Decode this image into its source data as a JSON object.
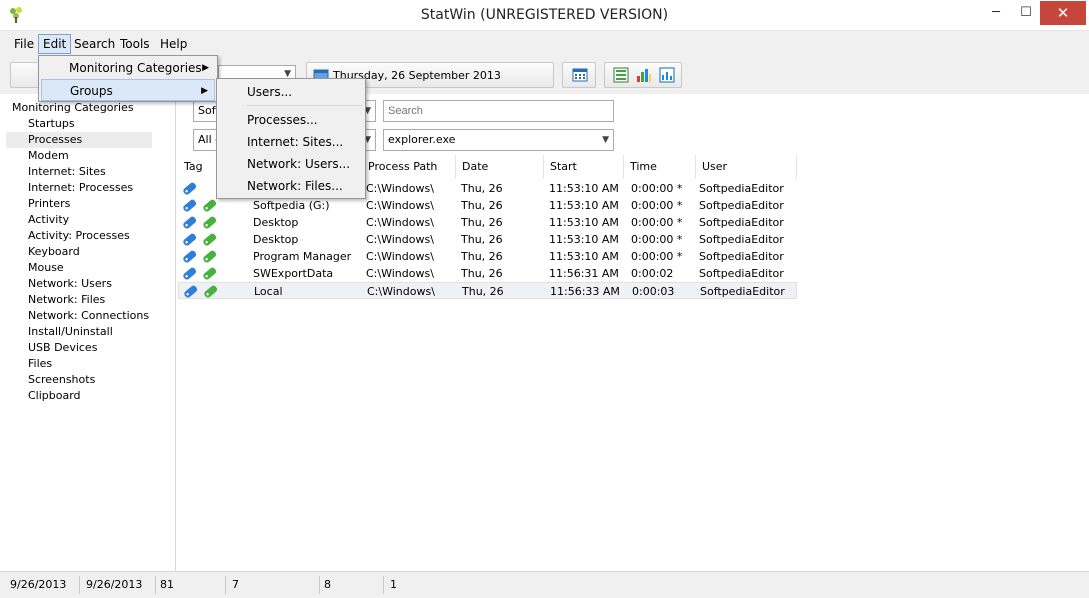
{
  "window": {
    "title": "StatWin (UNREGISTERED VERSION)",
    "min_glyph": "─",
    "max_glyph": "☐",
    "close_glyph": "✕"
  },
  "menu": {
    "file": "File",
    "edit": "Edit",
    "search": "Search",
    "tools": "Tools",
    "help": "Help"
  },
  "edit_menu": {
    "items": [
      "Monitoring Categories",
      "Groups"
    ]
  },
  "groups_submenu": {
    "items": [
      "Users...",
      "Processes...",
      "Internet: Sites...",
      "Network: Users...",
      "Network: Files..."
    ]
  },
  "toolbar": {
    "date": "Thursday, 26 September 2013"
  },
  "tree": {
    "root": "Monitoring Categories",
    "items": [
      "Startups",
      "Processes",
      "Modem",
      "Internet: Sites",
      "Internet: Processes",
      "Printers",
      "Activity",
      "Activity: Processes",
      "Keyboard",
      "Mouse",
      "Network: Users",
      "Network: Files",
      "Network: Connections",
      "Install/Uninstall",
      "USB Devices",
      "Files",
      "Screenshots",
      "Clipboard"
    ],
    "selected": "Processes"
  },
  "filters": {
    "combo1_value": "Soft",
    "combo2_value": "All g",
    "search_placeholder": "Search",
    "process_value": "explorer.exe"
  },
  "table": {
    "columns": [
      "Tag",
      "",
      "Process Path",
      "Date",
      "Start",
      "Time",
      "User"
    ],
    "rows": [
      [
        "",
        "",
        "C:\\Windows\\",
        "Thu, 26",
        "11:53:10 AM",
        "0:00:00 *",
        "SoftpediaEditor"
      ],
      [
        "",
        "Softpedia (G:)",
        "C:\\Windows\\",
        "Thu, 26",
        "11:53:10 AM",
        "0:00:00 *",
        "SoftpediaEditor"
      ],
      [
        "",
        "Desktop",
        "C:\\Windows\\",
        "Thu, 26",
        "11:53:10 AM",
        "0:00:00 *",
        "SoftpediaEditor"
      ],
      [
        "",
        "Desktop",
        "C:\\Windows\\",
        "Thu, 26",
        "11:53:10 AM",
        "0:00:00 *",
        "SoftpediaEditor"
      ],
      [
        "",
        "Program Manager",
        "C:\\Windows\\",
        "Thu, 26",
        "11:53:10 AM",
        "0:00:00 *",
        "SoftpediaEditor"
      ],
      [
        "",
        "SWExportData",
        "C:\\Windows\\",
        "Thu, 26",
        "11:56:31 AM",
        "0:00:02",
        "SoftpediaEditor"
      ],
      [
        "",
        "Local",
        "C:\\Windows\\",
        "Thu, 26",
        "11:56:33 AM",
        "0:00:03",
        "SoftpediaEditor"
      ]
    ]
  },
  "statusbar": {
    "cells": [
      "9/26/2013",
      "9/26/2013",
      "81",
      "7",
      "8",
      "1"
    ]
  },
  "colors": {
    "accent": "#dbe8f7",
    "close": "#c7463c",
    "tag_blue": "#2f7fd8",
    "tag_green": "#47b13d"
  }
}
